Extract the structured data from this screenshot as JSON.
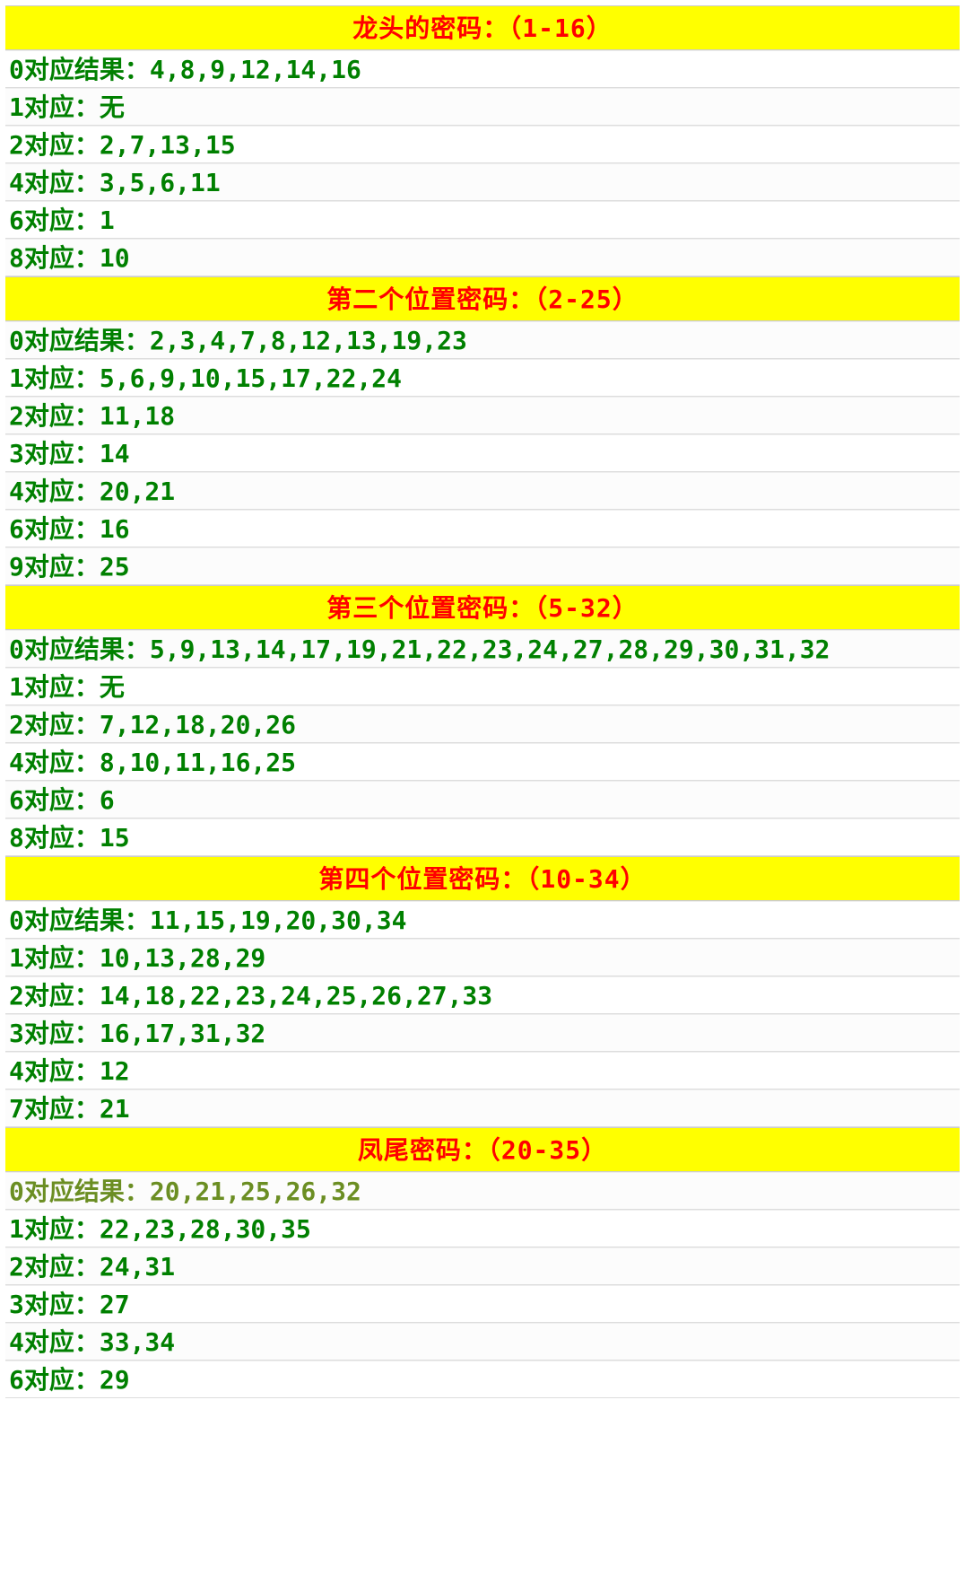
{
  "sections": [
    {
      "title": "龙头的密码：（1-16）",
      "rows": [
        "0对应结果：4,8,9,12,14,16",
        "1对应：无",
        "2对应：2,7,13,15",
        "4对应：3,5,6,11",
        "6对应：1",
        "8对应：10"
      ]
    },
    {
      "title": "第二个位置密码：（2-25）",
      "rows": [
        "0对应结果：2,3,4,7,8,12,13,19,23",
        "1对应：5,6,9,10,15,17,22,24",
        "2对应：11,18",
        "3对应：14",
        "4对应：20,21",
        "6对应：16",
        "9对应：25"
      ]
    },
    {
      "title": "第三个位置密码：（5-32）",
      "rows": [
        "0对应结果：5,9,13,14,17,19,21,22,23,24,27,28,29,30,31,32",
        "1对应：无",
        "2对应：7,12,18,20,26",
        "4对应：8,10,11,16,25",
        "6对应：6",
        "8对应：15"
      ]
    },
    {
      "title": "第四个位置密码：（10-34）",
      "rows": [
        "0对应结果：11,15,19,20,30,34",
        "1对应：10,13,28,29",
        "2对应：14,18,22,23,24,25,26,27,33",
        "3对应：16,17,31,32",
        "4对应：12",
        "7对应：21"
      ]
    },
    {
      "title": "凤尾密码：（20-35）",
      "dim_first": true,
      "rows": [
        "0对应结果：20,21,25,26,32",
        "1对应：22,23,28,30,35",
        "2对应：24,31",
        "3对应：27",
        "4对应：33,34",
        "6对应：29"
      ]
    }
  ]
}
